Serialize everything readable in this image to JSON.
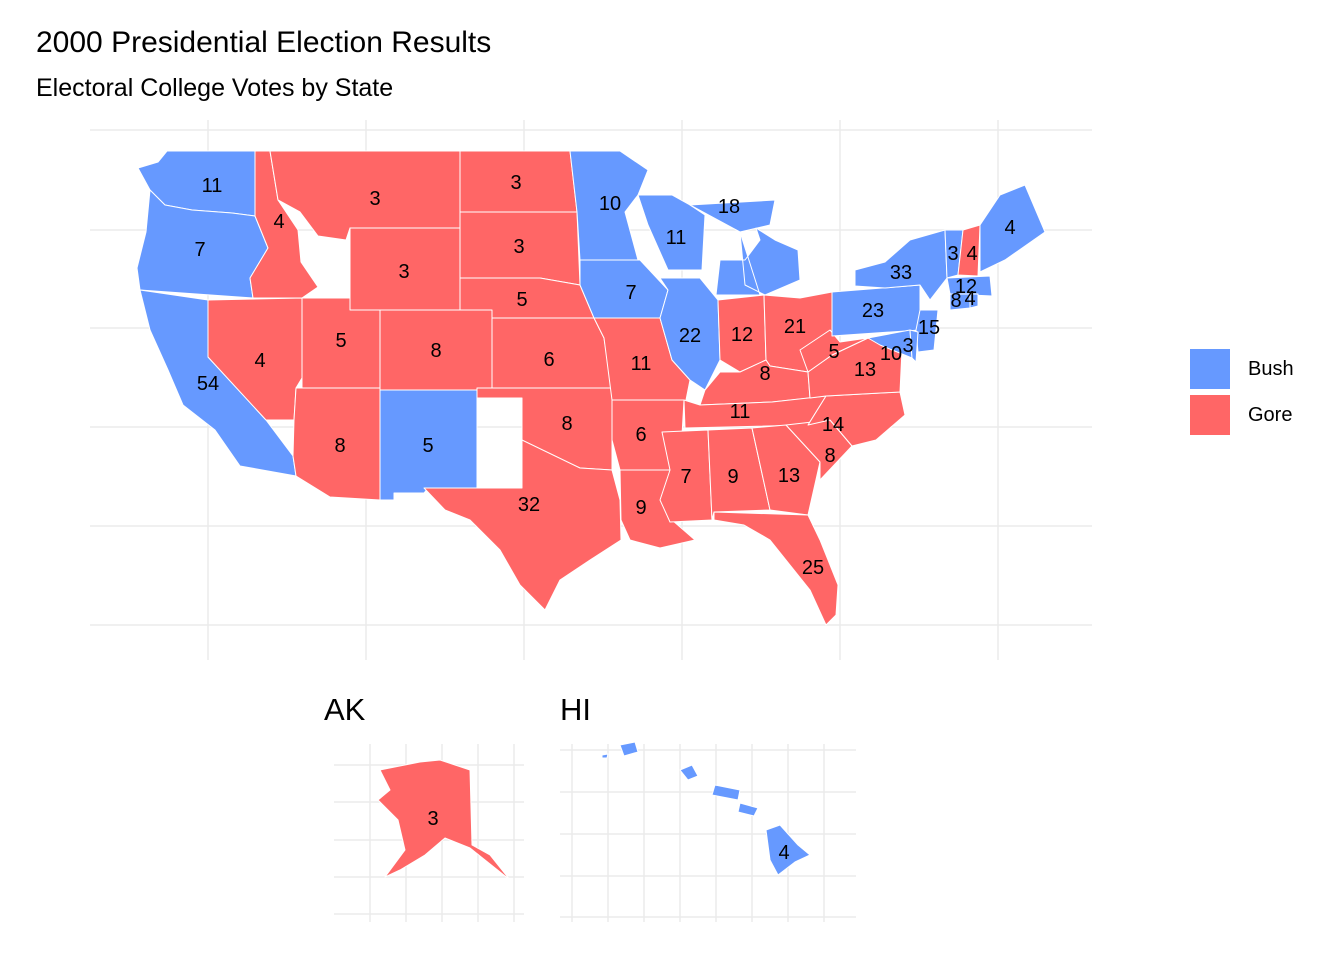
{
  "title": "2000 Presidential Election Results",
  "subtitle": "Electoral College Votes by State",
  "colors": {
    "Bush": "#6699FF",
    "Gore": "#FF6666"
  },
  "legend": [
    {
      "label": "Bush",
      "color": "#6699FF"
    },
    {
      "label": "Gore",
      "color": "#FF6666"
    }
  ],
  "insets": {
    "alaska_label": "AK",
    "hawaii_label": "HI"
  },
  "states": [
    {
      "abbr": "WA",
      "winner": "Bush",
      "votes": 11
    },
    {
      "abbr": "OR",
      "winner": "Bush",
      "votes": 7
    },
    {
      "abbr": "CA",
      "winner": "Bush",
      "votes": 54
    },
    {
      "abbr": "ID",
      "winner": "Gore",
      "votes": 4
    },
    {
      "abbr": "NV",
      "winner": "Gore",
      "votes": 4
    },
    {
      "abbr": "MT",
      "winner": "Gore",
      "votes": 3
    },
    {
      "abbr": "WY",
      "winner": "Gore",
      "votes": 3
    },
    {
      "abbr": "UT",
      "winner": "Gore",
      "votes": 5
    },
    {
      "abbr": "CO",
      "winner": "Gore",
      "votes": 8
    },
    {
      "abbr": "AZ",
      "winner": "Gore",
      "votes": 8
    },
    {
      "abbr": "NM",
      "winner": "Bush",
      "votes": 5
    },
    {
      "abbr": "ND",
      "winner": "Gore",
      "votes": 3
    },
    {
      "abbr": "SD",
      "winner": "Gore",
      "votes": 3
    },
    {
      "abbr": "NE",
      "winner": "Gore",
      "votes": 5
    },
    {
      "abbr": "KS",
      "winner": "Gore",
      "votes": 6
    },
    {
      "abbr": "OK",
      "winner": "Gore",
      "votes": 8
    },
    {
      "abbr": "TX",
      "winner": "Gore",
      "votes": 32
    },
    {
      "abbr": "MN",
      "winner": "Bush",
      "votes": 10
    },
    {
      "abbr": "IA",
      "winner": "Bush",
      "votes": 7
    },
    {
      "abbr": "MO",
      "winner": "Gore",
      "votes": 11
    },
    {
      "abbr": "AR",
      "winner": "Gore",
      "votes": 6
    },
    {
      "abbr": "LA",
      "winner": "Gore",
      "votes": 9
    },
    {
      "abbr": "WI",
      "winner": "Bush",
      "votes": 11
    },
    {
      "abbr": "MI",
      "winner": "Bush",
      "votes": 18
    },
    {
      "abbr": "IL",
      "winner": "Bush",
      "votes": 22
    },
    {
      "abbr": "IN",
      "winner": "Gore",
      "votes": 12
    },
    {
      "abbr": "OH",
      "winner": "Gore",
      "votes": 21
    },
    {
      "abbr": "KY",
      "winner": "Gore",
      "votes": 8
    },
    {
      "abbr": "TN",
      "winner": "Gore",
      "votes": 11
    },
    {
      "abbr": "MS",
      "winner": "Gore",
      "votes": 7
    },
    {
      "abbr": "AL",
      "winner": "Gore",
      "votes": 9
    },
    {
      "abbr": "GA",
      "winner": "Gore",
      "votes": 13
    },
    {
      "abbr": "FL",
      "winner": "Gore",
      "votes": 25
    },
    {
      "abbr": "SC",
      "winner": "Gore",
      "votes": 8
    },
    {
      "abbr": "NC",
      "winner": "Gore",
      "votes": 14
    },
    {
      "abbr": "VA",
      "winner": "Gore",
      "votes": 13
    },
    {
      "abbr": "WV",
      "winner": "Gore",
      "votes": 5
    },
    {
      "abbr": "PA",
      "winner": "Bush",
      "votes": 23
    },
    {
      "abbr": "NY",
      "winner": "Bush",
      "votes": 33
    },
    {
      "abbr": "VT",
      "winner": "Bush",
      "votes": 3
    },
    {
      "abbr": "NH",
      "winner": "Gore",
      "votes": 4
    },
    {
      "abbr": "ME",
      "winner": "Bush",
      "votes": 4
    },
    {
      "abbr": "MA",
      "winner": "Bush",
      "votes": 12
    },
    {
      "abbr": "CT",
      "winner": "Bush",
      "votes": 8
    },
    {
      "abbr": "RI",
      "winner": "Bush",
      "votes": 4
    },
    {
      "abbr": "NJ",
      "winner": "Bush",
      "votes": 15
    },
    {
      "abbr": "MD",
      "winner": "Bush",
      "votes": 10
    },
    {
      "abbr": "DE",
      "winner": "Bush",
      "votes": 3
    },
    {
      "abbr": "AK",
      "winner": "Gore",
      "votes": 3
    },
    {
      "abbr": "HI",
      "winner": "Bush",
      "votes": 4
    }
  ]
}
